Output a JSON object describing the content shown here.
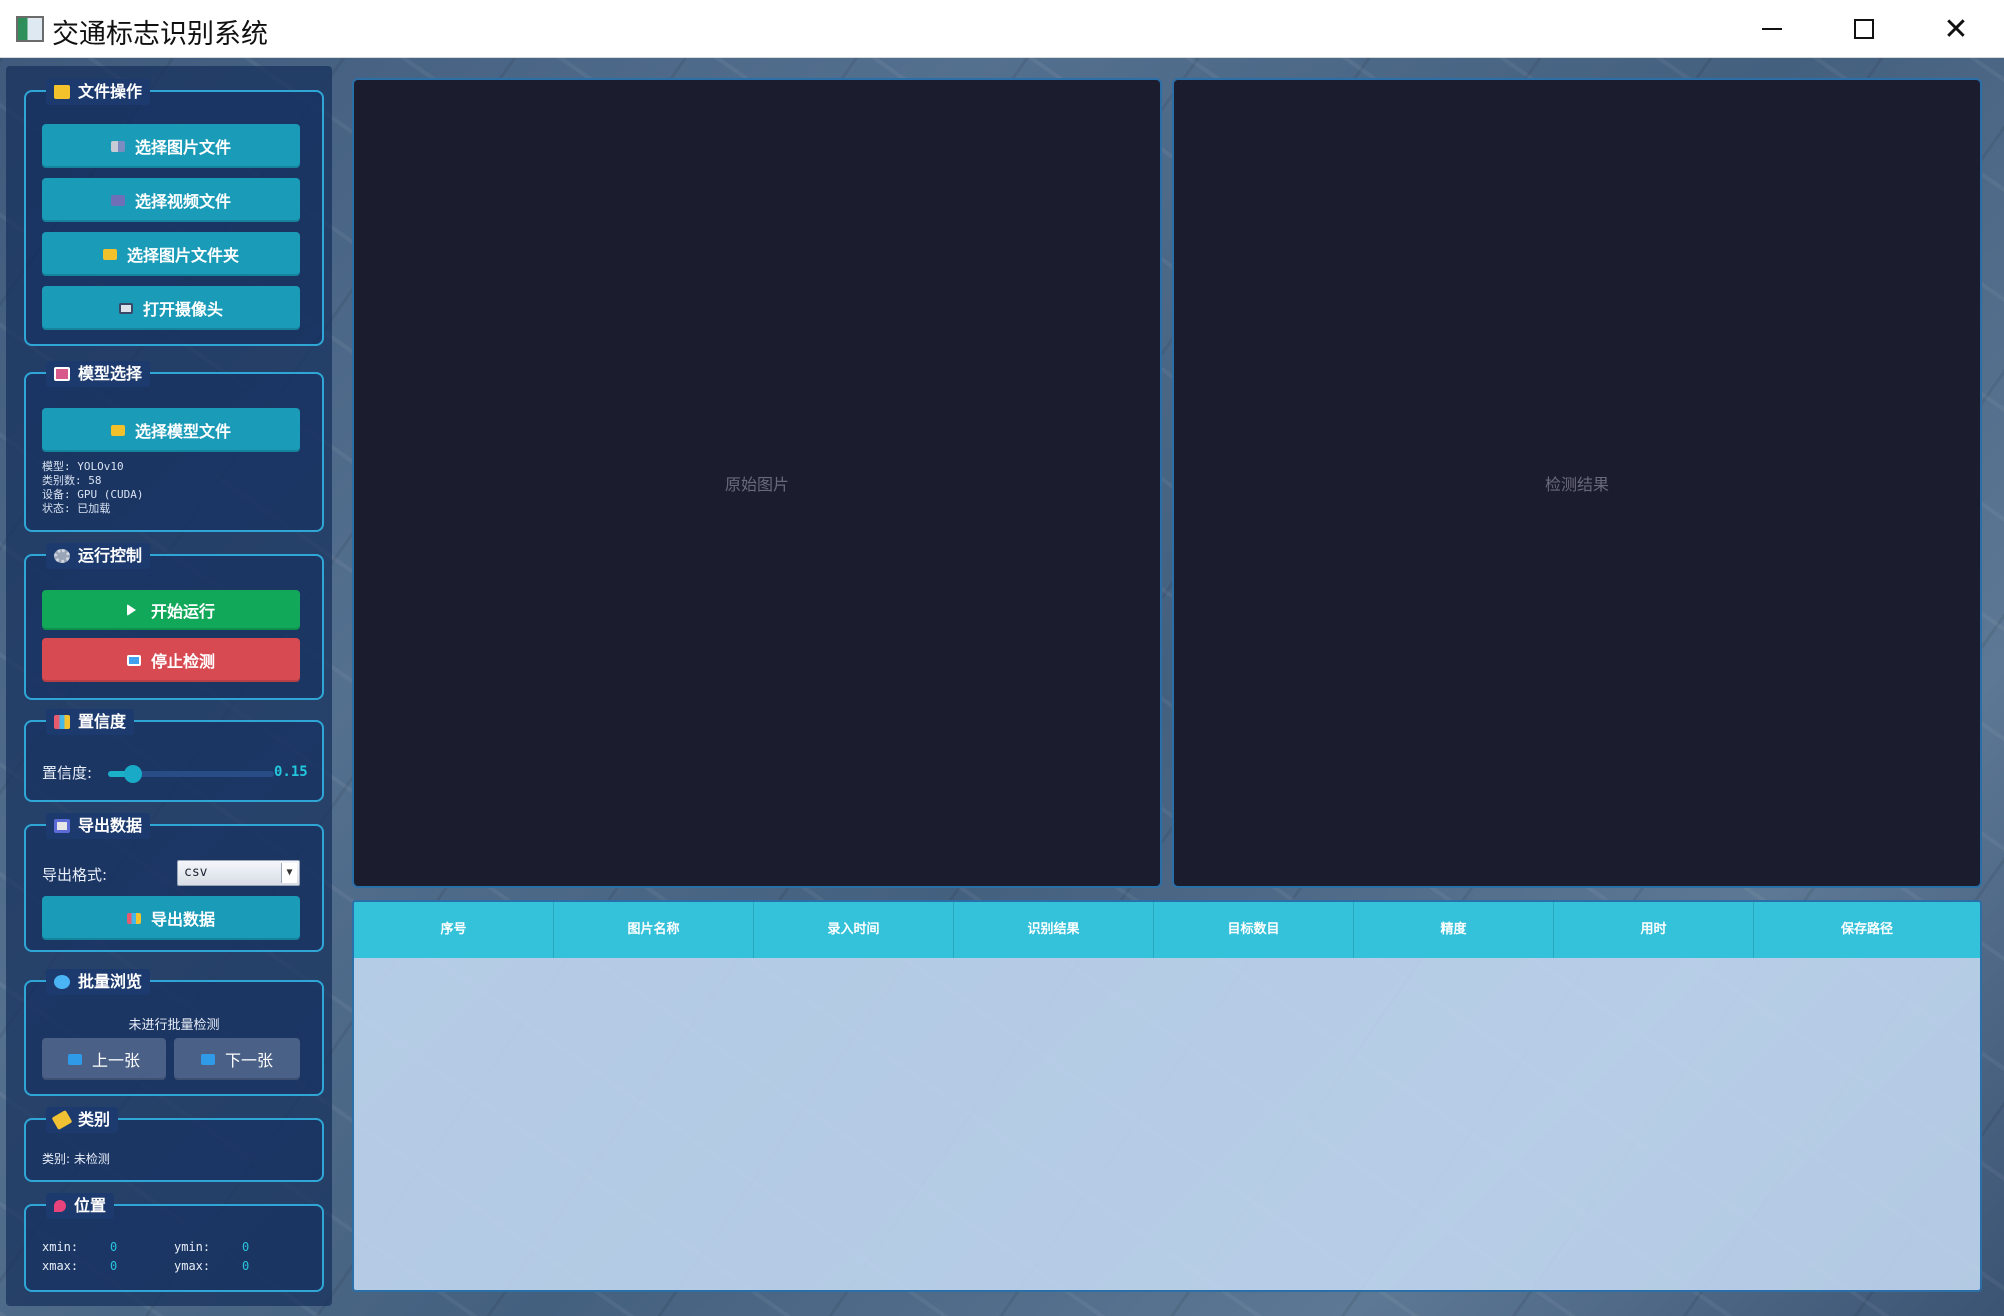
{
  "window": {
    "title": "交通标志识别系统"
  },
  "file_ops": {
    "title": "文件操作",
    "buttons": [
      "选择图片文件",
      "选择视频文件",
      "选择图片文件夹",
      "打开摄像头"
    ]
  },
  "model": {
    "title": "模型选择",
    "button": "选择模型文件",
    "info": [
      "模型: YOLOv10",
      "类别数: 58",
      "设备: GPU (CUDA)",
      "状态: 已加载"
    ]
  },
  "run": {
    "title": "运行控制",
    "start": "开始运行",
    "stop": "停止检测"
  },
  "confidence": {
    "title": "置信度",
    "label": "置信度:",
    "value": "0.15",
    "level": 0.15
  },
  "export": {
    "title": "导出数据",
    "format_label": "导出格式:",
    "format_value": "csv",
    "button": "导出数据"
  },
  "batch": {
    "title": "批量浏览",
    "status": "未进行批量检测",
    "prev": "上一张",
    "next": "下一张"
  },
  "category": {
    "title": "类别",
    "text": "类别: 未检测"
  },
  "position": {
    "title": "位置",
    "xmin_label": "xmin:",
    "xmin": "0",
    "ymin_label": "ymin:",
    "ymin": "0",
    "xmax_label": "xmax:",
    "xmax": "0",
    "ymax_label": "ymax:",
    "ymax": "0"
  },
  "panels": {
    "original": "原始图片",
    "result": "检测结果"
  },
  "table": {
    "columns": [
      "序号",
      "图片名称",
      "录入时间",
      "识别结果",
      "目标数目",
      "精度",
      "用时",
      "保存路径"
    ],
    "rows": []
  },
  "colors": {
    "accent": "#1a9bb8",
    "start": "#11a85a",
    "stop": "#d84a52",
    "panel": "#1c1c2f",
    "table_header": "#34c1da"
  }
}
